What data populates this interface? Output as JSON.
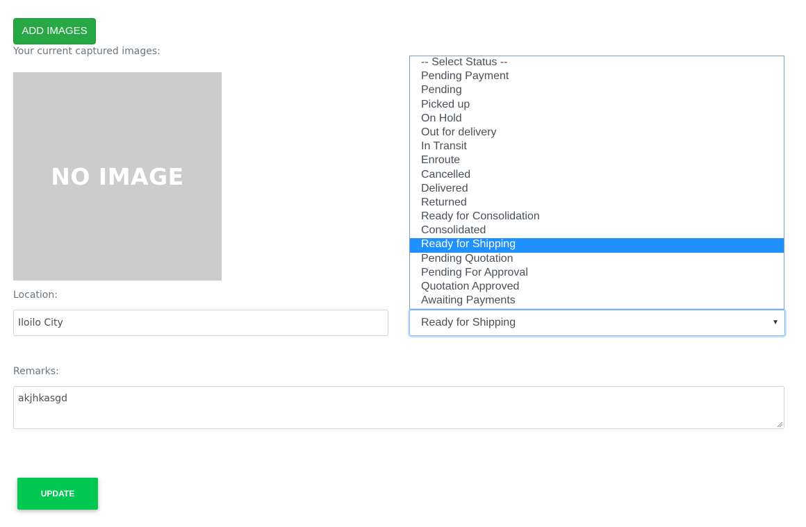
{
  "buttons": {
    "add_images": "ADD IMAGES",
    "update": "UPDATE"
  },
  "images": {
    "label": "Your current captured images:",
    "placeholder_text": "NO IMAGE"
  },
  "location": {
    "label": "Location:",
    "value": "Iloilo City"
  },
  "status": {
    "selected": "Ready for Shipping",
    "options": [
      "-- Select Status --",
      "Pending Payment",
      "Pending",
      "Picked up",
      "On Hold",
      "Out for delivery",
      "In Transit",
      "Enroute",
      "Cancelled",
      "Delivered",
      "Returned",
      "Ready for Consolidation",
      "Consolidated",
      "Ready for Shipping",
      "Pending Quotation",
      "Pending For Approval",
      "Quotation Approved",
      "Awaiting Payments"
    ],
    "highlighted_index": 13
  },
  "remarks": {
    "label": "Remarks:",
    "value": "akjhkasgd"
  },
  "colors": {
    "add_button": "#28a745",
    "update_button": "#00c851",
    "highlight": "#1e90ff",
    "no_image_bg": "#cccccc"
  }
}
